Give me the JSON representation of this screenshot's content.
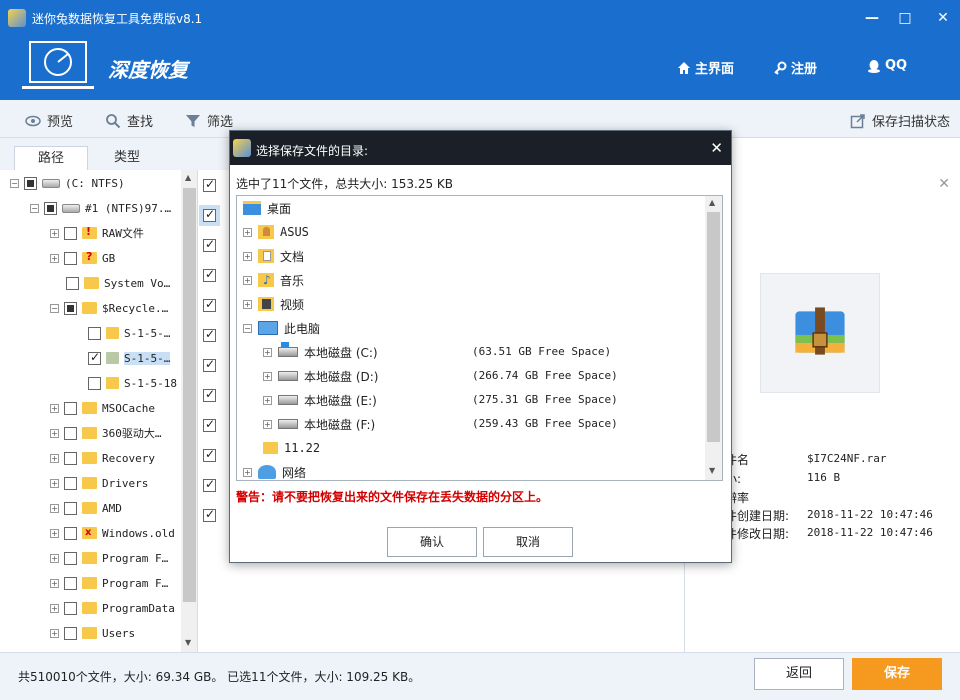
{
  "window": {
    "title": "迷你兔数据恢复工具免费版v8.1",
    "min": "—",
    "max": "□",
    "close": "✕"
  },
  "header": {
    "brand": "深度恢复",
    "links": [
      {
        "label": "主界面"
      },
      {
        "label": "注册"
      },
      {
        "label": "QQ"
      }
    ],
    "colors": {
      "primary": "#1a6fce",
      "accent": "#f59a1e"
    }
  },
  "toolbar": {
    "preview": "预览",
    "find": "查找",
    "filter": "筛选",
    "save_scan": "保存扫描状态"
  },
  "tabs": [
    {
      "label": "路径"
    },
    {
      "label": "类型"
    }
  ],
  "tree": {
    "items": [
      {
        "label": "(C: NTFS)"
      },
      {
        "label": "#1 (NTFS)97.…"
      },
      {
        "label": "RAW文件"
      },
      {
        "label": "GB"
      },
      {
        "label": "System Vo…"
      },
      {
        "label": "$Recycle.…"
      },
      {
        "label": "S-1-5-…"
      },
      {
        "label": "S-1-5-…"
      },
      {
        "label": "S-1-5-18"
      },
      {
        "label": "MSOCache"
      },
      {
        "label": "360驱动大…"
      },
      {
        "label": "Recovery"
      },
      {
        "label": "Drivers"
      },
      {
        "label": "AMD"
      },
      {
        "label": "Windows.old"
      },
      {
        "label": "Program F…"
      },
      {
        "label": "Program F…"
      },
      {
        "label": "ProgramData"
      },
      {
        "label": "Users"
      }
    ]
  },
  "preview": {
    "close": "✕",
    "fields": [
      {
        "label": "件名",
        "value": "$I7C24NF.rar"
      },
      {
        "label": "小:",
        "value": "116 B"
      },
      {
        "label": "辨率",
        "value": ""
      },
      {
        "label": "件创建日期:",
        "value": "2018-11-22 10:47:46"
      },
      {
        "label": "件修改日期:",
        "value": "2018-11-22 10:47:46"
      }
    ]
  },
  "status": {
    "text": "共510010个文件，大小: 69.34 GB。 已选11个文件，大小: 109.25 KB。",
    "back": "返回",
    "save": "保存"
  },
  "dialog": {
    "title": "选择保存文件的目录:",
    "close": "✕",
    "summary": "选中了11个文件，总共大小: 153.25 KB",
    "tree": {
      "desktop": "桌面",
      "asus": "ASUS",
      "docs": "文档",
      "music": "音乐",
      "video": "视频",
      "pc": "此电脑",
      "disks": [
        {
          "label": "本地磁盘 (C:)",
          "free": "(63.51 GB Free Space)"
        },
        {
          "label": "本地磁盘 (D:)",
          "free": "(266.74 GB Free Space)"
        },
        {
          "label": "本地磁盘 (E:)",
          "free": "(275.31 GB Free Space)"
        },
        {
          "label": "本地磁盘 (F:)",
          "free": "(259.43 GB Free Space)"
        }
      ],
      "folder": "11.22",
      "network": "网络"
    },
    "warning": "警告：请不要把恢复出来的文件保存在丢失数据的分区上。",
    "ok": "确认",
    "cancel": "取消"
  }
}
